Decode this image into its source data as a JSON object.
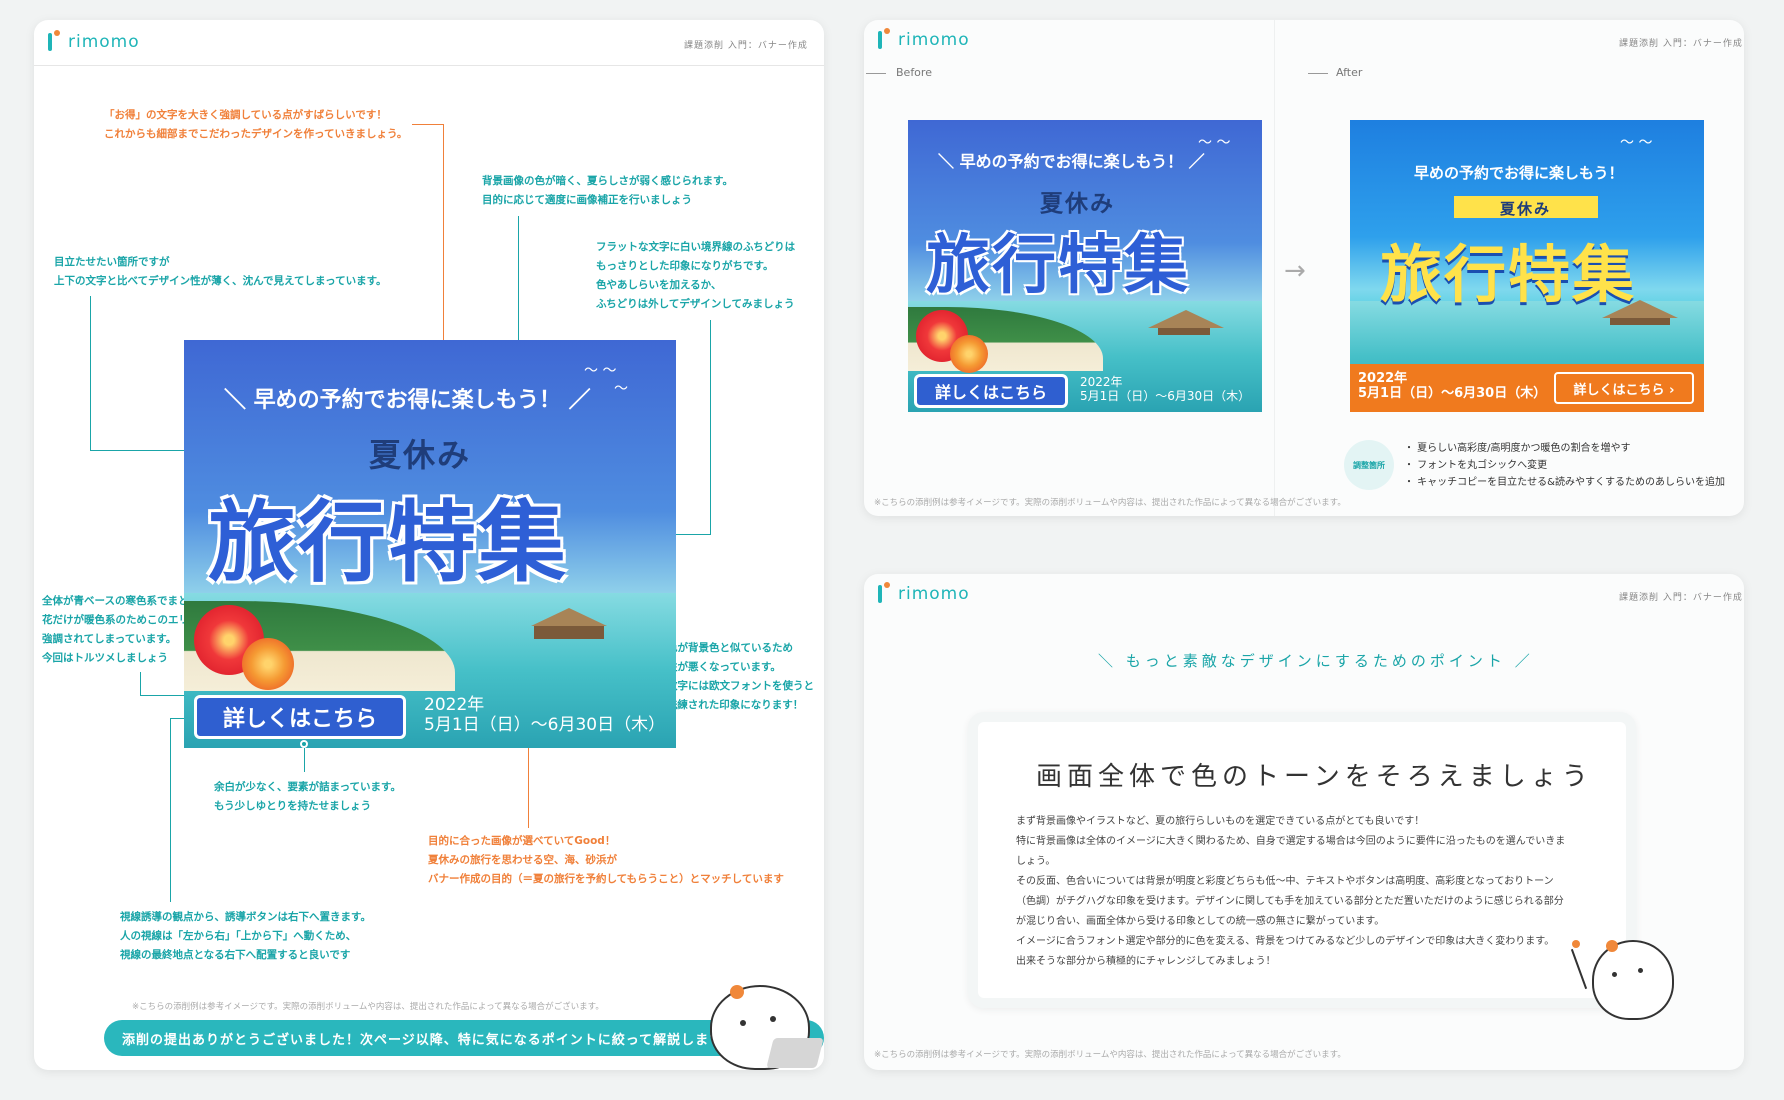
{
  "brand": "rimomo",
  "breadcrumb": "課題添削 入門：バナー作成",
  "left": {
    "notes": [
      "「お得」の文字を大きく強調している点がすばらしいです！",
      "これからも細部までこだわったデザインを作っていきましょう。",
      "背景画像の色が暗く、夏らしさが弱く感じられます。",
      "目的に応じて適度に画像補正を行いましょう",
      "目立たせたい箇所ですが",
      "上下の文字と比べてデザイン性が薄く、沈んで見えてしまっています。",
      "フラットな文字に白い境界線のふちどりは",
      "もっさりとした印象になりがちです。",
      "色やあしらいを加えるか、",
      "ふちどりは外してデザインしてみましょう",
      "全体が青ベースの寒色系でまとまっている中、",
      "花だけが暖色系のためこのエリアが過剰に",
      "強調されてしまっています。",
      "今回はトルツメしましょう",
      "文字色が背景色と似ているため",
      "視認性が悪くなっています。",
      "また数字には欧文フォントを使うと",
      "より洗練された印象になります！",
      "余白が少なく、要素が詰まっています。",
      "もう少しゆとりを持たせましょう",
      "目的に合った画像が選べていてGood！",
      "夏休みの旅行を思わせる空、海、砂浜が",
      "バナー作成の目的（＝夏の旅行を予約してもらうこと）とマッチしています",
      "視線誘導の観点から、誘導ボタンは右下へ置きます。",
      "人の視線は「左から右」「上から下」へ動くため、",
      "視線の最終地点となる右下へ配置すると良いです"
    ],
    "footnote": "※こちらの添削例は参考イメージです。実際の添削ボリュームや内容は、提出された作品によって異なる場合がございます。",
    "cta": "添削の提出ありがとうございました！次ページ以降、特に気になるポイントに絞って解説します"
  },
  "banner": {
    "tagline": "＼ 早めの予約でお得に楽しもう！ ／",
    "tagline_after": "早めの予約でお得に楽しもう！",
    "subtitle": "夏休み",
    "title": "旅行特集",
    "button": "詳しくはこちら",
    "button_after": "詳しくはこちら ›",
    "year": "2022年",
    "dates": "5月1日（日）〜6月30日（木）",
    "dates_after": "5月1日（日）〜6月30日（木）"
  },
  "beforeAfter": {
    "before_label": "Before",
    "after_label": "After",
    "badge": "調整箇所",
    "bullets": [
      "・ 夏らしい高彩度/高明度かつ暖色の割合を増やす",
      "・ フォントを丸ゴシックへ変更",
      "・ キャッチコピーを目立たせる&読みやすくするためのあしらいを追加"
    ]
  },
  "points": {
    "heading": "＼ もっと素敵なデザインにするためのポイント ／",
    "title": "画面全体で色のトーンをそろえましょう",
    "body": [
      "まず背景画像やイラストなど、夏の旅行らしいものを選定できている点がとても良いです！",
      "特に背景画像は全体のイメージに大きく関わるため、自身で選定する場合は今回のように要件に沿ったものを選んでいきま",
      "しょう。",
      "その反面、色合いについては背景が明度と彩度どちらも低〜中、テキストやボタンは高明度、高彩度となっておりトーン",
      "（色調）がチグハグな印象を受けます。デザインに関しても手を加えている部分とただ置いただけのように感じられる部分",
      "が混じり合い、画面全体から受ける印象としての統一感の無さに繋がっています。",
      "イメージに合うフォント選定や部分的に色を変える、背景をつけてみるなど少しのデザインで印象は大きく変わります。",
      "出来そうな部分から積極的にチャレンジしてみましょう！"
    ]
  },
  "colors": {
    "accent": "#1aa5a8",
    "orange": "#f0803a",
    "banner_blue": "#3f68d4",
    "after_yellow": "#ffe24a"
  }
}
